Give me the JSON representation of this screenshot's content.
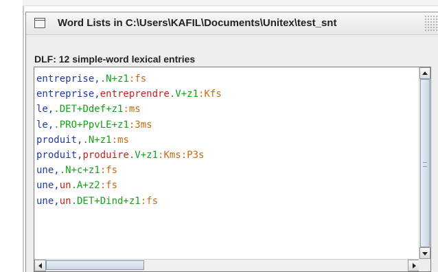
{
  "window": {
    "title": "Word Lists in C:\\Users\\KAFIL\\Documents\\Unitex\\test_snt",
    "icon": "window-icon"
  },
  "dlf": {
    "label": "DLF: 12 simple-word lexical entries"
  },
  "colors": {
    "inflected_form": "#1f3c9e",
    "lemma": "#c81e1e",
    "grammatical_codes": "#16a016",
    "inflection_codes": "#c76a12"
  },
  "entries": [
    {
      "form": "entreprise,",
      "lemma": "",
      "codes": ".N+z1",
      "inflection": ":fs"
    },
    {
      "form": "entreprise,",
      "lemma": "entreprendre",
      "codes": ".V+z1",
      "inflection": ":Kfs"
    },
    {
      "form": "le,",
      "lemma": "",
      "codes": ".DET+Ddef+z1",
      "inflection": ":ms"
    },
    {
      "form": "le,",
      "lemma": "",
      "codes": ".PRO+PpvLE+z1",
      "inflection": ":3ms"
    },
    {
      "form": "produit,",
      "lemma": "",
      "codes": ".N+z1",
      "inflection": ":ms"
    },
    {
      "form": "produit,",
      "lemma": "produire",
      "codes": ".V+z1",
      "inflection": ":Kms:P3s"
    },
    {
      "form": "une,",
      "lemma": "",
      "codes": ".N+c+z1",
      "inflection": ":fs"
    },
    {
      "form": "une,",
      "lemma": "un",
      "codes": ".A+z2",
      "inflection": ":fs"
    },
    {
      "form": "une,",
      "lemma": "un",
      "codes": ".DET+Dind+z1",
      "inflection": ":fs"
    }
  ],
  "scrollbars": {
    "vertical_position": 0.0,
    "horizontal_position": 0.0
  }
}
